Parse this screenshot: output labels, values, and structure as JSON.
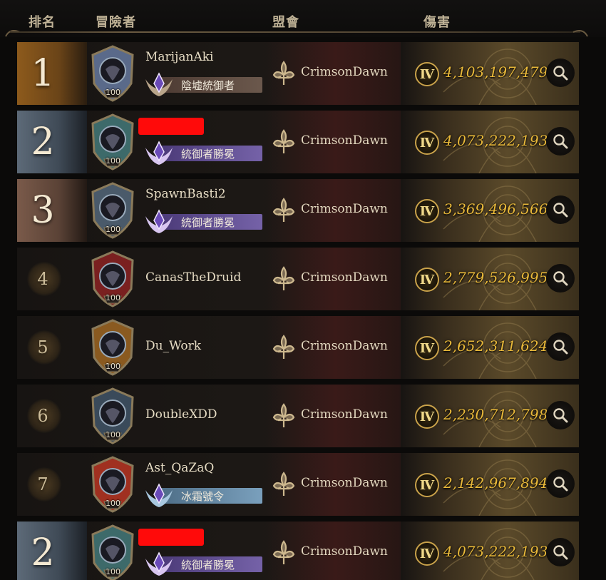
{
  "header": {
    "rank_label": "排名",
    "adventurer_label": "冒險者",
    "clan_label": "盟會",
    "damage_label": "傷害"
  },
  "rows": [
    {
      "rank": "1",
      "tier": "gold",
      "name": "MarijanAki",
      "redacted": false,
      "level": "100",
      "badge": {
        "label": "陰墟統御者",
        "style": "brown"
      },
      "clan": "CrimsonDawn",
      "tier_icon": "Ⅳ",
      "damage": "4,103,197,479"
    },
    {
      "rank": "2",
      "tier": "silver",
      "name": "",
      "redacted": true,
      "level": "100",
      "badge": {
        "label": "統御者勝冕",
        "style": "purple"
      },
      "clan": "CrimsonDawn",
      "tier_icon": "Ⅳ",
      "damage": "4,073,222,193"
    },
    {
      "rank": "3",
      "tier": "bronze",
      "name": "SpawnBasti2",
      "redacted": false,
      "level": "100",
      "badge": {
        "label": "統御者勝冕",
        "style": "purple"
      },
      "clan": "CrimsonDawn",
      "tier_icon": "Ⅳ",
      "damage": "3,369,496,566"
    },
    {
      "rank": "4",
      "tier": "normal",
      "name": "CanasTheDruid",
      "redacted": false,
      "level": "100",
      "badge": null,
      "clan": "CrimsonDawn",
      "tier_icon": "Ⅳ",
      "damage": "2,779,526,995"
    },
    {
      "rank": "5",
      "tier": "normal",
      "name": "Du_Work",
      "redacted": false,
      "level": "100",
      "badge": null,
      "clan": "CrimsonDawn",
      "tier_icon": "Ⅳ",
      "damage": "2,652,311,624"
    },
    {
      "rank": "6",
      "tier": "normal",
      "name": "DoubleXDD",
      "redacted": false,
      "level": "100",
      "badge": null,
      "clan": "CrimsonDawn",
      "tier_icon": "Ⅳ",
      "damage": "2,230,712,798"
    },
    {
      "rank": "7",
      "tier": "normal",
      "name": "Ast_QaZaQ",
      "redacted": false,
      "level": "100",
      "badge": {
        "label": "冰霜號令",
        "style": "ice"
      },
      "clan": "CrimsonDawn",
      "tier_icon": "Ⅳ",
      "damage": "2,142,967,894"
    },
    {
      "rank": "2",
      "tier": "silver",
      "name": "",
      "redacted": true,
      "level": "100",
      "badge": {
        "label": "統御者勝冕",
        "style": "purple"
      },
      "clan": "CrimsonDawn",
      "tier_icon": "Ⅳ",
      "damage": "4,073,222,193"
    }
  ],
  "colors": {
    "damage": "#e9b93a",
    "redaction": "#ff0a0a",
    "gold_tier": "#8d5a1c",
    "silver_tier": "#5d6a78",
    "bronze_tier": "#7a5a4a"
  },
  "icons": {
    "clan": "fleur-de-lis-icon",
    "tier": "roman-four-medal-icon",
    "inspect": "magnifier-icon"
  }
}
